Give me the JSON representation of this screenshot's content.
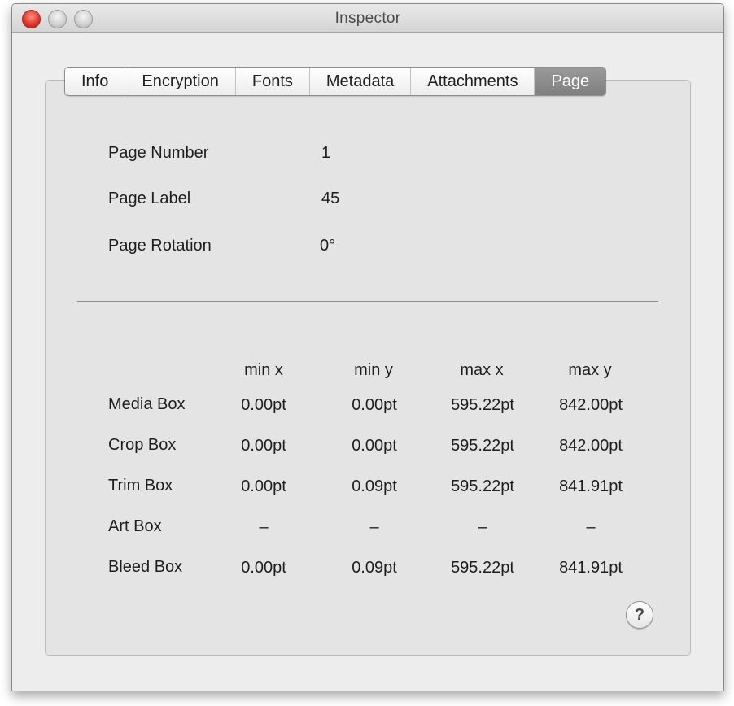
{
  "window": {
    "title": "Inspector"
  },
  "tabs": [
    {
      "label": "Info"
    },
    {
      "label": "Encryption"
    },
    {
      "label": "Fonts"
    },
    {
      "label": "Metadata"
    },
    {
      "label": "Attachments"
    },
    {
      "label": "Page",
      "active": true
    }
  ],
  "page_info": [
    {
      "label": "Page Number",
      "value": "1"
    },
    {
      "label": "Page Label",
      "value": "45"
    },
    {
      "label": "Page Rotation",
      "value": "0°"
    }
  ],
  "boxes_table": {
    "columns": [
      "min x",
      "min y",
      "max x",
      "max y"
    ],
    "rows": [
      {
        "label": "Media Box",
        "values": [
          "0.00pt",
          "0.00pt",
          "595.22pt",
          "842.00pt"
        ]
      },
      {
        "label": "Crop Box",
        "values": [
          "0.00pt",
          "0.00pt",
          "595.22pt",
          "842.00pt"
        ]
      },
      {
        "label": "Trim Box",
        "values": [
          "0.00pt",
          "0.09pt",
          "595.22pt",
          "841.91pt"
        ]
      },
      {
        "label": "Art Box",
        "values": [
          "–",
          "–",
          "–",
          "–"
        ]
      },
      {
        "label": "Bleed Box",
        "values": [
          "0.00pt",
          "0.09pt",
          "595.22pt",
          "841.91pt"
        ]
      }
    ]
  },
  "help": {
    "label": "?"
  }
}
